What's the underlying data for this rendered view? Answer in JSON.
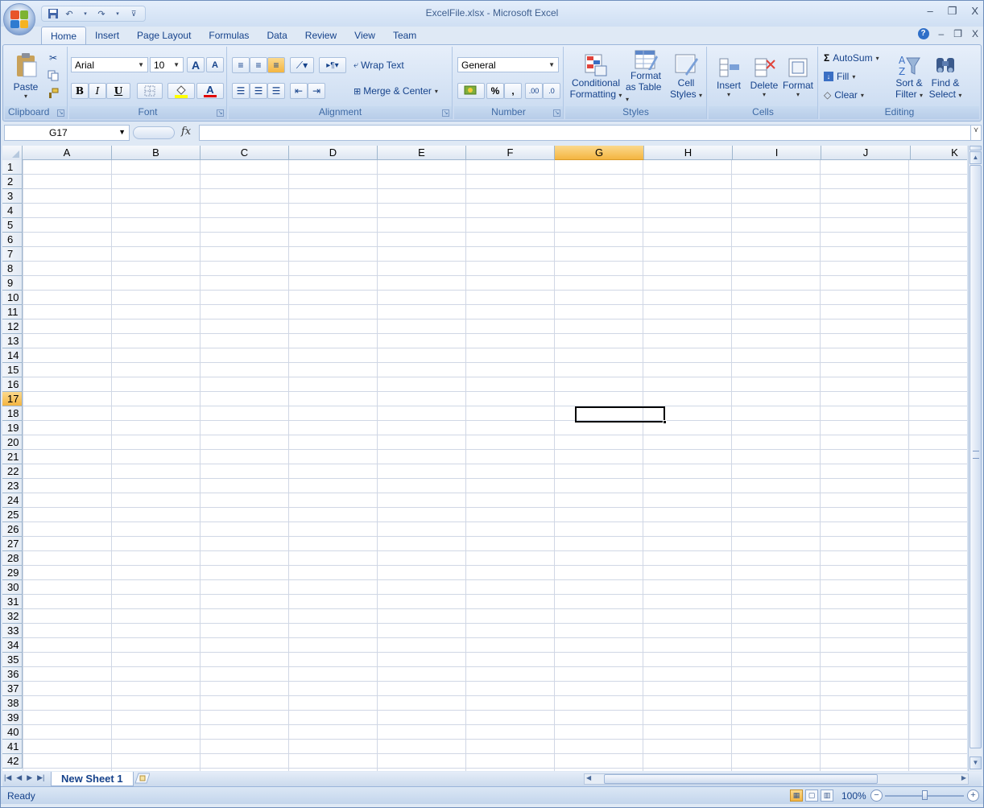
{
  "window": {
    "title": "ExcelFile.xlsx - Microsoft Excel",
    "minimize": "–",
    "restore": "❐",
    "close": "X"
  },
  "doc_controls": {
    "help": "?",
    "minimize": "–",
    "restore": "❐",
    "close": "X"
  },
  "tabs": [
    "Home",
    "Insert",
    "Page Layout",
    "Formulas",
    "Data",
    "Review",
    "View",
    "Team"
  ],
  "active_tab": "Home",
  "ribbon": {
    "clipboard": {
      "label": "Clipboard",
      "paste": "Paste"
    },
    "font": {
      "label": "Font",
      "name": "Arial",
      "size": "10",
      "bold": "B",
      "italic": "I",
      "underline": "U",
      "grow": "A",
      "shrink": "A"
    },
    "alignment": {
      "label": "Alignment",
      "wrap_text": "Wrap Text",
      "merge_center": "Merge & Center"
    },
    "number": {
      "label": "Number",
      "format": "General",
      "percent": "%",
      "comma": ",",
      "inc_decimal": ".00",
      "dec_decimal": ".0"
    },
    "styles": {
      "label": "Styles",
      "conditional_1": "Conditional",
      "conditional_2": "Formatting",
      "format_table_1": "Format",
      "format_table_2": "as Table",
      "cell_styles_1": "Cell",
      "cell_styles_2": "Styles"
    },
    "cells": {
      "label": "Cells",
      "insert": "Insert",
      "delete": "Delete",
      "format": "Format"
    },
    "editing": {
      "label": "Editing",
      "autosum": "AutoSum",
      "fill": "Fill",
      "clear": "Clear",
      "sort_1": "Sort &",
      "sort_2": "Filter",
      "find_1": "Find &",
      "find_2": "Select"
    }
  },
  "formula_bar": {
    "name_box": "G17",
    "fx": "fx",
    "value": ""
  },
  "columns": [
    "A",
    "B",
    "C",
    "D",
    "E",
    "F",
    "G",
    "H",
    "I",
    "J",
    "K"
  ],
  "rows": [
    "1",
    "2",
    "3",
    "4",
    "5",
    "6",
    "7",
    "8",
    "9",
    "10",
    "11",
    "12",
    "13",
    "14",
    "15",
    "16",
    "17",
    "18",
    "19",
    "20",
    "21",
    "22",
    "23",
    "24",
    "25",
    "26",
    "27",
    "28",
    "29",
    "30",
    "31",
    "32",
    "33",
    "34",
    "35",
    "36",
    "37",
    "38",
    "39",
    "40",
    "41",
    "42"
  ],
  "selected_cell": {
    "column": "G",
    "row": "17"
  },
  "sheet_tabs": [
    "New Sheet 1"
  ],
  "status": {
    "text": "Ready",
    "zoom": "100%",
    "zoom_out": "−",
    "zoom_in": "+"
  },
  "colors": {
    "accent": "#15428b",
    "selection": "#f4b541",
    "ribbon_bg": "#dfe9f5"
  },
  "icons": {
    "office": "office-button-icon",
    "save": "save-icon",
    "undo": "undo-icon",
    "redo": "redo-icon",
    "cut": "cut-icon",
    "copy": "copy-icon",
    "format_painter": "format-painter-icon"
  }
}
